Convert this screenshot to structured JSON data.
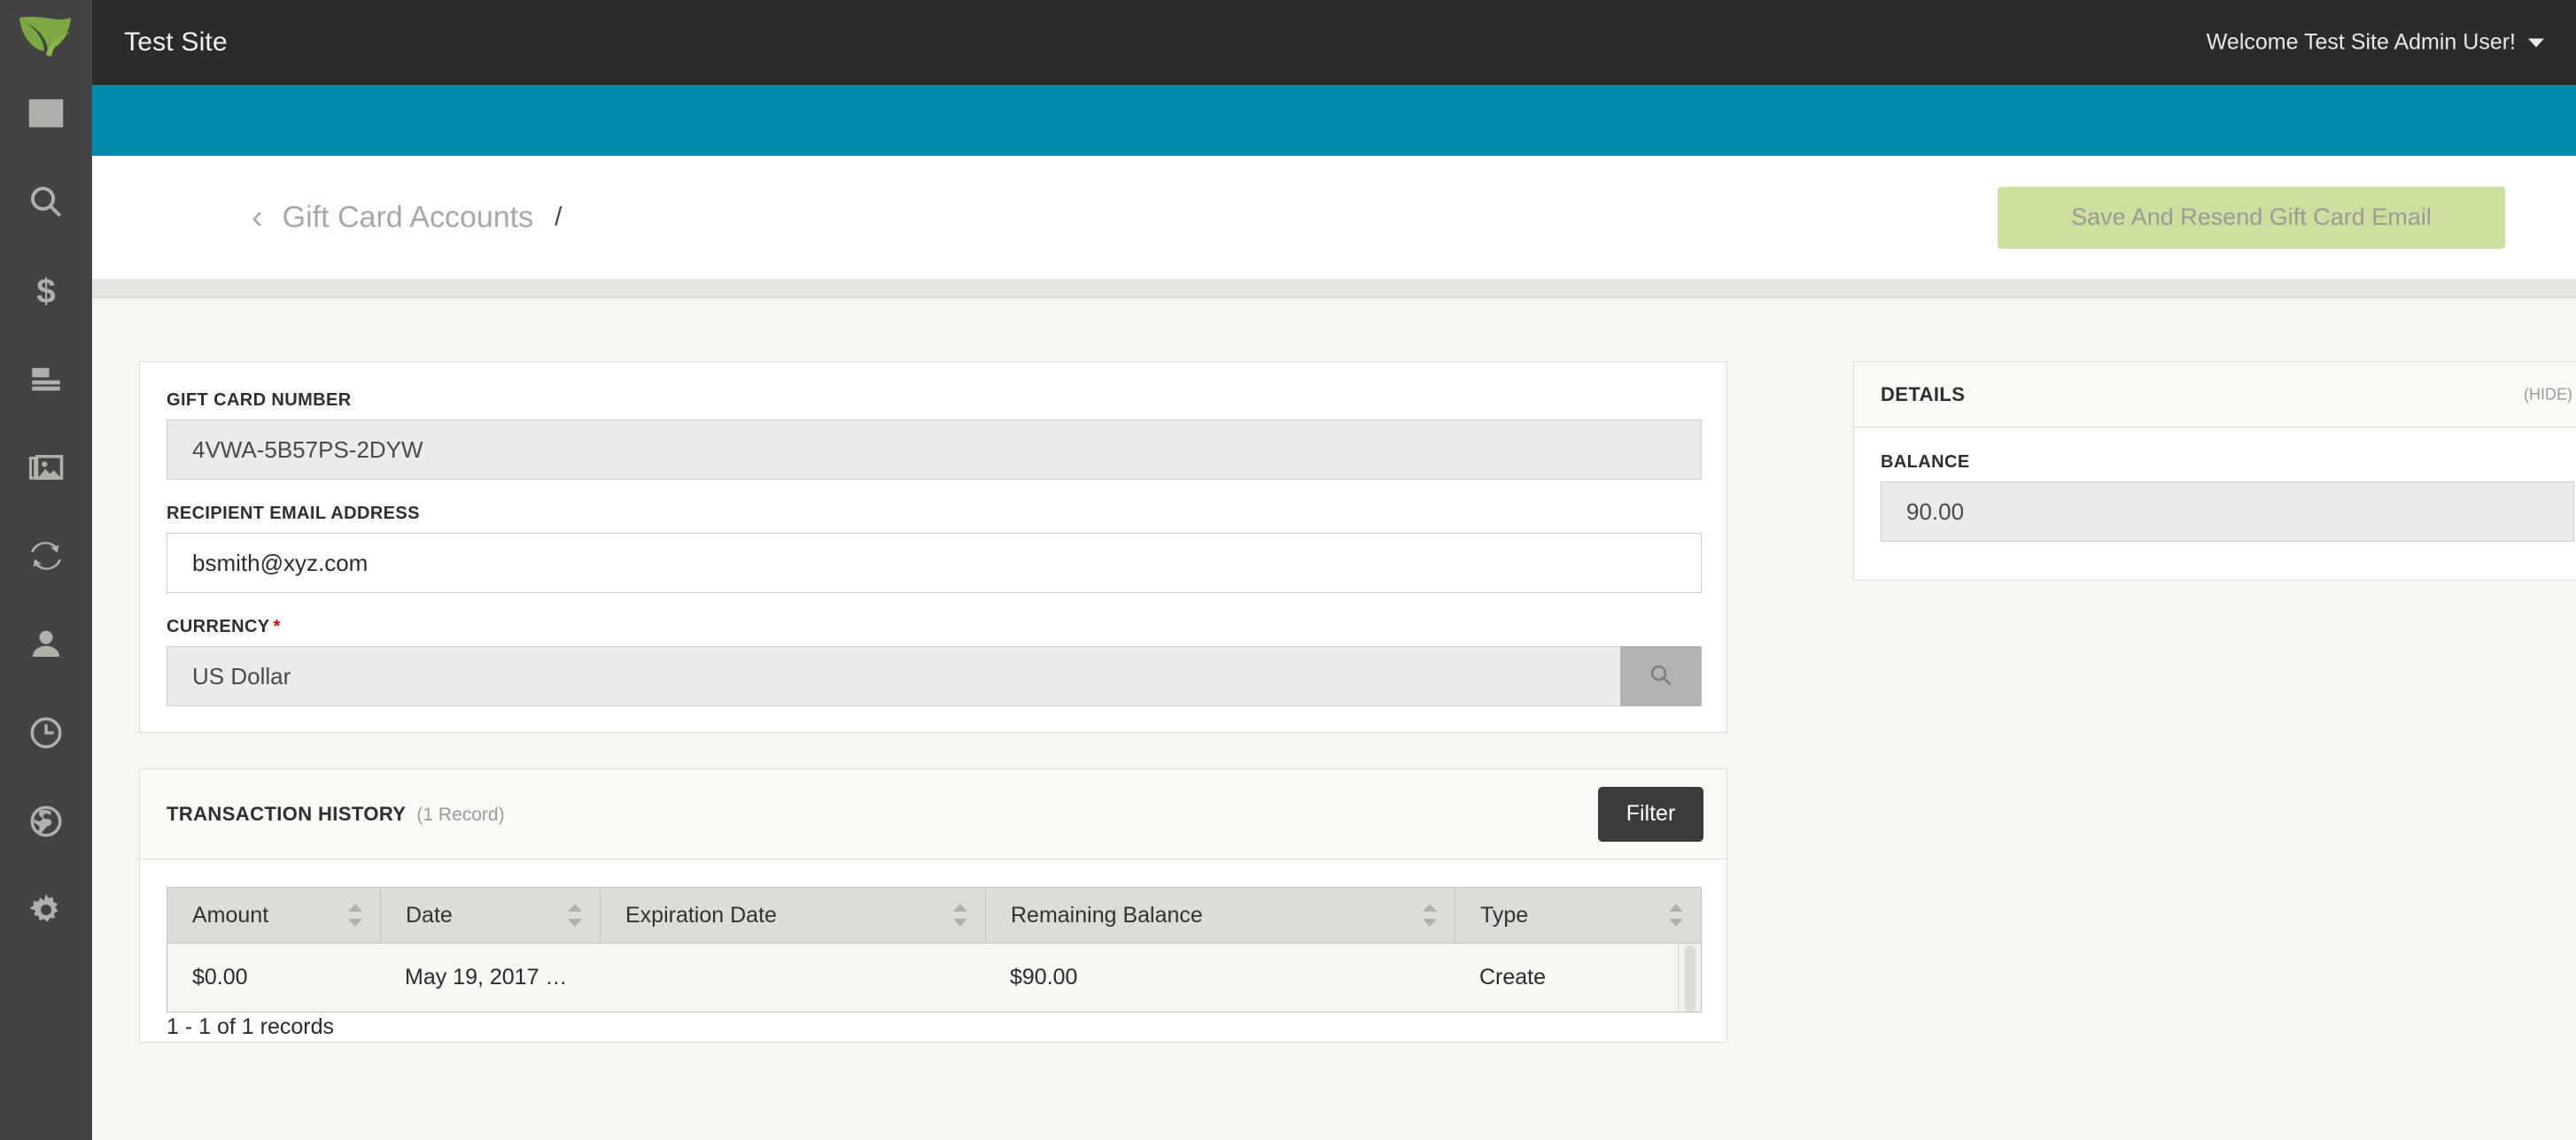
{
  "sidebar": {
    "logo_name": "leaf-logo",
    "items": [
      {
        "name": "sidebar-item-dashboard",
        "icon": "dashboard-icon"
      },
      {
        "name": "sidebar-item-search",
        "icon": "search-icon"
      },
      {
        "name": "sidebar-item-sales",
        "icon": "dollar-icon"
      },
      {
        "name": "sidebar-item-catalog",
        "icon": "catalog-icon"
      },
      {
        "name": "sidebar-item-media",
        "icon": "image-icon"
      },
      {
        "name": "sidebar-item-sync",
        "icon": "sync-icon"
      },
      {
        "name": "sidebar-item-customers",
        "icon": "user-icon"
      },
      {
        "name": "sidebar-item-history",
        "icon": "clock-icon"
      },
      {
        "name": "sidebar-item-global",
        "icon": "globe-icon"
      },
      {
        "name": "sidebar-item-settings",
        "icon": "gear-icon"
      }
    ]
  },
  "topbar": {
    "title": "Test Site",
    "user_greeting": "Welcome Test Site Admin User!"
  },
  "header": {
    "back_chevron": "‹",
    "breadcrumb_parent": "Gift Card Accounts",
    "breadcrumb_separator": "/",
    "save_button": "Save And Resend Gift Card Email"
  },
  "form": {
    "fields": [
      {
        "label": "Gift Card Number",
        "value": "4VWA-5B57PS-2DYW",
        "readonly": true,
        "required": false
      },
      {
        "label": "Recipient Email Address",
        "value": "bsmith@xyz.com",
        "readonly": false,
        "required": false
      },
      {
        "label": "Currency",
        "value": "US Dollar",
        "readonly": true,
        "required": true,
        "search_button_icon": "search-icon"
      }
    ],
    "required_marker": "*"
  },
  "transaction_history": {
    "title": "Transaction History",
    "count_label": "(1 Record)",
    "filter_button": "Filter",
    "columns": [
      {
        "label": "Amount",
        "sortable": true
      },
      {
        "label": "Date",
        "sortable": true
      },
      {
        "label": "Expiration Date",
        "sortable": true
      },
      {
        "label": "Remaining Balance",
        "sortable": true
      },
      {
        "label": "Type",
        "sortable": true
      }
    ],
    "rows": [
      {
        "amount": "$0.00",
        "date": "May 19, 2017 …",
        "expiration_date": "",
        "remaining_balance": "$90.00",
        "type": "Create"
      }
    ],
    "records_count": "1 - 1 of 1 records"
  },
  "details": {
    "title": "Details",
    "hide_label": "(HIDE)",
    "balance_label": "Balance",
    "balance_value": "90.00"
  },
  "colors": {
    "topbar_bg": "#2b2b2b",
    "accent_blue": "#0589af",
    "sidebar_bg": "#434343",
    "page_bg": "#f7f6f2",
    "save_button_bg": "#cddf9f",
    "filter_button_bg": "#3b3b3b",
    "required_star": "#d0021b",
    "logo_green": "#7ba842"
  }
}
